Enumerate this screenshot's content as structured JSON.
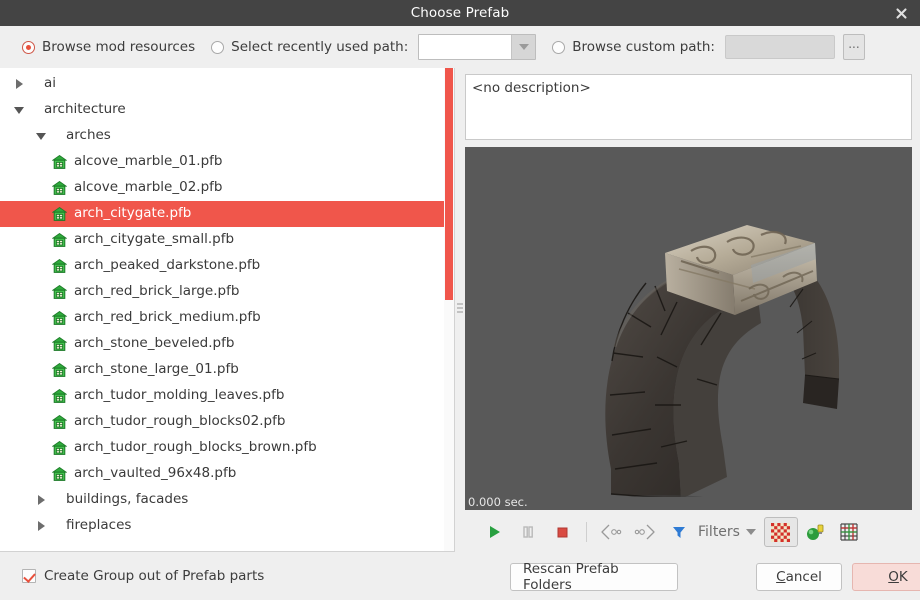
{
  "window": {
    "title": "Choose Prefab",
    "close_icon": "close-icon"
  },
  "options": {
    "browse_mod_resources": {
      "label": "Browse mod resources",
      "selected": true
    },
    "select_recent_path": {
      "label": "Select recently used path:",
      "selected": false,
      "combo_value": "",
      "combo_icon": "chevron-down-icon"
    },
    "browse_custom_path": {
      "label": "Browse custom path:",
      "selected": false,
      "path_value": "",
      "browse_button_label": "..."
    }
  },
  "tree": {
    "nodes": [
      {
        "label": "ai",
        "indent": 0,
        "type": "folder",
        "state": "collapsed",
        "selected": false
      },
      {
        "label": "architecture",
        "indent": 0,
        "type": "folder",
        "state": "expanded",
        "selected": false
      },
      {
        "label": "arches",
        "indent": 1,
        "type": "folder",
        "state": "expanded",
        "selected": false
      },
      {
        "label": "alcove_marble_01.pfb",
        "indent": 2,
        "type": "prefab",
        "state": "leaf",
        "selected": false
      },
      {
        "label": "alcove_marble_02.pfb",
        "indent": 2,
        "type": "prefab",
        "state": "leaf",
        "selected": false
      },
      {
        "label": "arch_citygate.pfb",
        "indent": 2,
        "type": "prefab",
        "state": "leaf",
        "selected": true
      },
      {
        "label": "arch_citygate_small.pfb",
        "indent": 2,
        "type": "prefab",
        "state": "leaf",
        "selected": false
      },
      {
        "label": "arch_peaked_darkstone.pfb",
        "indent": 2,
        "type": "prefab",
        "state": "leaf",
        "selected": false
      },
      {
        "label": "arch_red_brick_large.pfb",
        "indent": 2,
        "type": "prefab",
        "state": "leaf",
        "selected": false
      },
      {
        "label": "arch_red_brick_medium.pfb",
        "indent": 2,
        "type": "prefab",
        "state": "leaf",
        "selected": false
      },
      {
        "label": "arch_stone_beveled.pfb",
        "indent": 2,
        "type": "prefab",
        "state": "leaf",
        "selected": false
      },
      {
        "label": "arch_stone_large_01.pfb",
        "indent": 2,
        "type": "prefab",
        "state": "leaf",
        "selected": false
      },
      {
        "label": "arch_tudor_molding_leaves.pfb",
        "indent": 2,
        "type": "prefab",
        "state": "leaf",
        "selected": false
      },
      {
        "label": "arch_tudor_rough_blocks02.pfb",
        "indent": 2,
        "type": "prefab",
        "state": "leaf",
        "selected": false
      },
      {
        "label": "arch_tudor_rough_blocks_brown.pfb",
        "indent": 2,
        "type": "prefab",
        "state": "leaf",
        "selected": false
      },
      {
        "label": "arch_vaulted_96x48.pfb",
        "indent": 2,
        "type": "prefab",
        "state": "leaf",
        "selected": false
      },
      {
        "label": "buildings, facades",
        "indent": 1,
        "type": "folder",
        "state": "collapsed",
        "selected": false
      },
      {
        "label": "fireplaces",
        "indent": 1,
        "type": "folder",
        "state": "collapsed",
        "selected": false
      }
    ],
    "selection_color": "#f0564b"
  },
  "create_group": {
    "label": "Create Group out of Prefab parts",
    "checked": true
  },
  "description": {
    "text": "<no description>"
  },
  "preview": {
    "time_label": "0.000 sec.",
    "background_color": "#595959"
  },
  "view_toolbar": {
    "play": "play-icon",
    "pause": "pause-icon",
    "stop": "stop-icon",
    "step_back": "step-back-icon",
    "step_forward": "step-forward-icon",
    "filters_icon": "funnel-icon",
    "filters_label": "Filters",
    "filters_dropdown": "chevron-down-icon",
    "checker_background": "checker-icon",
    "lighting": "light-sphere-icon",
    "grid": "grid-icon"
  },
  "buttons": {
    "rescan": "Rescan Prefab Folders",
    "cancel_prefix": "",
    "cancel_mnemonic": "C",
    "cancel_rest": "ancel",
    "ok_mnemonic": "O",
    "ok_rest": "K"
  }
}
